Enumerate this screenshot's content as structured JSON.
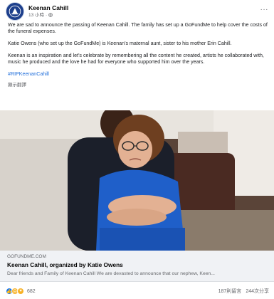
{
  "post": {
    "author": "Keenan Cahill",
    "time": "13 小時",
    "more": "···",
    "paragraphs": [
      "We are sad to announce the passing of Keenan Cahill.  The family has set up a GoFundMe to help cover the costs of the funeral expenses.",
      "Katie Owens (who set up the GoFundMe) is Keenan’s maternal aunt, sister to his mother Erin Cahill.",
      "Keenan is an inspiration and let’s celebrate by remembering all the content he created, artists he collaborated with, music he produced and the love he had for everyone who supported him over the years."
    ],
    "hashtag": "#RIPKeenanCahill",
    "translate": "顯示翻譯"
  },
  "link_preview": {
    "domain": "GOFUNDME.COM",
    "title": "Keenan Cahill, organized by Katie Owens",
    "description": "Dear friends and Family of Keenan Cahill We are devasted to announce that our nephew, Keen..."
  },
  "stats": {
    "reaction_count": "682",
    "comments": "187則留言",
    "shares": "244次分享"
  },
  "colors": {
    "accent": "#216fdb",
    "like": "#1877f2",
    "muted": "#65676b"
  }
}
